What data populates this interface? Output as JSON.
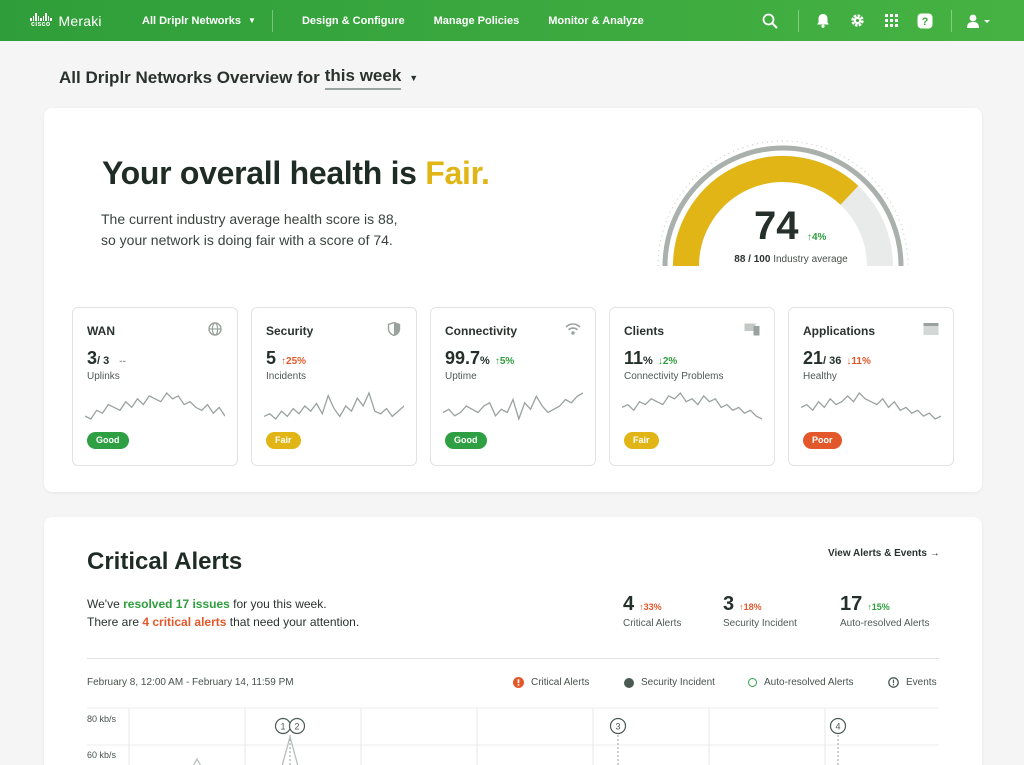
{
  "nav": {
    "brand": "Meraki",
    "cisco": "cisco",
    "network_selector": "All Driplr Networks",
    "items": [
      "Design & Configure",
      "Manage Policies",
      "Monitor & Analyze"
    ],
    "icons": [
      "search-icon",
      "bell-icon",
      "gear-icon",
      "apps-grid-icon",
      "help-icon",
      "user-icon"
    ]
  },
  "page": {
    "title_prefix": "All Driplr Networks Overview for",
    "period": "this week"
  },
  "health": {
    "title_prefix": "Your overall health is",
    "rating": "Fair.",
    "desc_line1": "The current industry average health score is 88,",
    "desc_line2": "so your network is doing fair with a score of 74.",
    "score": 74,
    "max": 100,
    "industry_average": 88,
    "change": "↑4%",
    "industry_value": "88 / 100",
    "industry_label": "Industry average",
    "colors": {
      "fair": "#e0b515",
      "track": "#e9ebea",
      "outline": "#aab1ad"
    }
  },
  "metrics": [
    {
      "title": "WAN",
      "icon": "globe-icon",
      "value": "3",
      "unit": "/ 3",
      "delta": "--",
      "delta_dir": "none",
      "sub": "Uplinks",
      "status": "Good",
      "status_class": "good",
      "spark": [
        6,
        5,
        8,
        7,
        10,
        9,
        8,
        11,
        9,
        12,
        10,
        13,
        12,
        11,
        14,
        12,
        13,
        10,
        11,
        9,
        8,
        10,
        7,
        9,
        6
      ]
    },
    {
      "title": "Security",
      "icon": "shield-icon",
      "value": "5",
      "unit": "",
      "delta": "↑25%",
      "delta_dir": "up-red",
      "sub": "Incidents",
      "status": "Fair",
      "status_class": "fair",
      "spark": [
        5,
        6,
        4,
        7,
        5,
        8,
        6,
        9,
        7,
        10,
        6,
        13,
        8,
        5,
        9,
        7,
        12,
        9,
        14,
        7,
        6,
        8,
        5,
        7,
        9
      ]
    },
    {
      "title": "Connectivity",
      "icon": "wifi-icon",
      "value": "99.7",
      "unit": "%",
      "delta": "↑5%",
      "delta_dir": "up-green",
      "sub": "Uptime",
      "status": "Good",
      "status_class": "good",
      "spark": [
        8,
        9,
        7,
        8,
        10,
        9,
        8,
        10,
        11,
        7,
        9,
        8,
        12,
        6,
        11,
        9,
        13,
        10,
        8,
        9,
        10,
        12,
        11,
        13,
        14
      ]
    },
    {
      "title": "Clients",
      "icon": "devices-icon",
      "value": "11",
      "unit": "%",
      "delta": "↓2%",
      "delta_dir": "down-green",
      "sub": "Connectivity Problems",
      "status": "Fair",
      "status_class": "fair",
      "spark": [
        9,
        10,
        8,
        11,
        10,
        12,
        11,
        10,
        13,
        12,
        14,
        11,
        12,
        10,
        13,
        11,
        12,
        9,
        10,
        8,
        9,
        7,
        8,
        6,
        5
      ]
    },
    {
      "title": "Applications",
      "icon": "window-icon",
      "value": "21",
      "unit": "/ 36",
      "delta": "↓11%",
      "delta_dir": "down-red",
      "sub": "Healthy",
      "status": "Poor",
      "status_class": "poor",
      "spark": [
        9,
        10,
        8,
        11,
        9,
        12,
        10,
        11,
        13,
        11,
        14,
        12,
        11,
        10,
        12,
        9,
        11,
        8,
        9,
        7,
        8,
        6,
        7,
        5,
        6
      ]
    }
  ],
  "alerts": {
    "title": "Critical Alerts",
    "view_link": "View Alerts & Events →",
    "desc": {
      "l1_a": "We've ",
      "l1_b": "resolved 17 issues",
      "l1_c": " for you this week.",
      "l2_a": "There are ",
      "l2_b": "4 critical alerts",
      "l2_c": " that need your attention."
    },
    "stats": [
      {
        "value": "4",
        "delta": "↑33%",
        "dir": "up-red",
        "label": "Critical Alerts"
      },
      {
        "value": "3",
        "delta": "↑18%",
        "dir": "up-red",
        "label": "Security Incident"
      },
      {
        "value": "17",
        "delta": "↑15%",
        "dir": "up-green",
        "label": "Auto-resolved Alerts"
      }
    ],
    "range": "February 8, 12:00 AM - February 14, 11:59 PM",
    "legend": [
      {
        "label": "Critical Alerts",
        "icon": "critical-alert-icon",
        "color": "#e3582b"
      },
      {
        "label": "Security Incident",
        "icon": "security-dot-icon",
        "color": "#4c5a53"
      },
      {
        "label": "Auto-resolved Alerts",
        "icon": "resolved-ring-icon",
        "color": "#2ea043"
      },
      {
        "label": "Events",
        "icon": "events-icon",
        "color": "#4c5a53"
      }
    ],
    "y_labels": [
      "80 kb/s",
      "60 kb/s"
    ],
    "event_markers": [
      "1",
      "2",
      "3",
      "4"
    ]
  }
}
